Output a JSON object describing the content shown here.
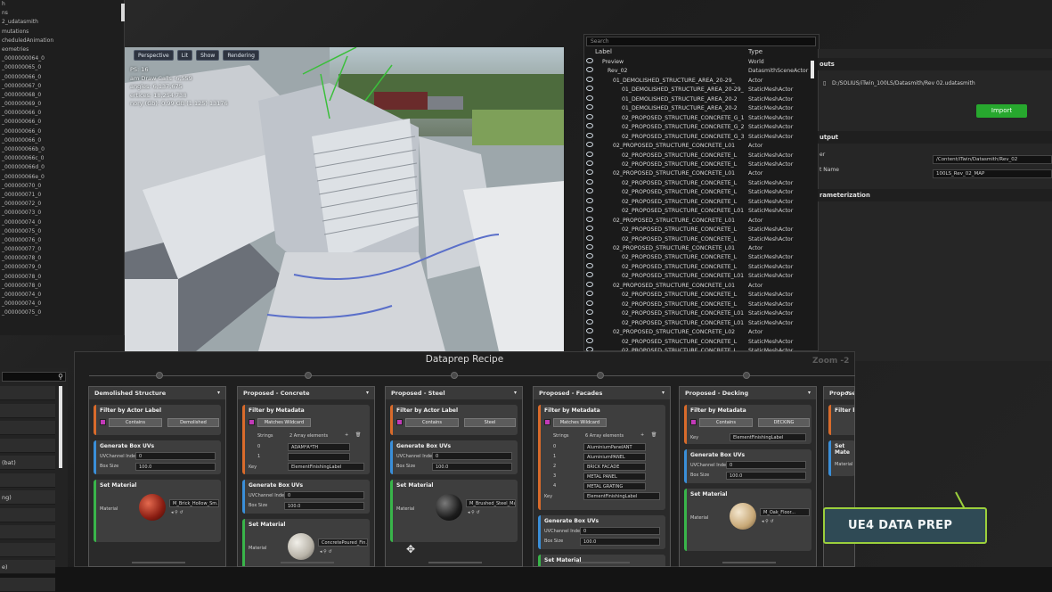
{
  "outliner_left": {
    "rows": [
      "h",
      "ns",
      "2_udatasmith",
      "mutations",
      "cheduledAnimation",
      "eometries",
      "_0000000064_0",
      "_000000065_0",
      "_000000066_0",
      "_000000067_0",
      "_000000068_0",
      "_000000069_0",
      "_000000066_0",
      "_000000066_0",
      "_000000066_0",
      "_000000066_0",
      "_000000066b_0",
      "_000000066c_0",
      "_000000066d_0",
      "_000000066e_0",
      "_000000070_0",
      "_000000071_0",
      "_000000072_0",
      "_000000073_0",
      "_000000074_0",
      "_000000075_0",
      "_000000076_0",
      "_000000077_0",
      "_000000078_0",
      "_000000079_0",
      "_000000078_0",
      "_000000078_0",
      "_000000074_0",
      "_000000074_0",
      "_000000075_0"
    ]
  },
  "viewport": {
    "toolbar": [
      "Perspective",
      "Lit",
      "Show",
      "Rendering"
    ],
    "stats": [
      "PS: 16",
      "am Draw Calls: 6,559",
      "angles: 6,137,675",
      "ertices: 18,254,738",
      "nory (Gb): 0.99 GB (1.125) 13176"
    ]
  },
  "scene_outliner": {
    "search_placeholder": "Search",
    "col_label": "Label",
    "col_type": "Type",
    "rows": [
      {
        "label": "Preview",
        "type": "World"
      },
      {
        "label": "Rev_02",
        "type": "DatasmithSceneActor"
      },
      {
        "label": "01_DEMOLISHED_STRUCTURE_AREA_20-29_",
        "type": "Actor"
      },
      {
        "label": "01_DEMOLISHED_STRUCTURE_AREA_20-29_",
        "type": "StaticMeshActor"
      },
      {
        "label": "01_DEMOLISHED_STRUCTURE_AREA_20-2",
        "type": "StaticMeshActor"
      },
      {
        "label": "01_DEMOLISHED_STRUCTURE_AREA_20-2",
        "type": "StaticMeshActor"
      },
      {
        "label": "02_PROPOSED_STRUCTURE_CONCRETE_G_1",
        "type": "StaticMeshActor"
      },
      {
        "label": "02_PROPOSED_STRUCTURE_CONCRETE_G_2",
        "type": "StaticMeshActor"
      },
      {
        "label": "02_PROPOSED_STRUCTURE_CONCRETE_G_3",
        "type": "StaticMeshActor"
      },
      {
        "label": "02_PROPOSED_STRUCTURE_CONCRETE_L01",
        "type": "Actor"
      },
      {
        "label": "02_PROPOSED_STRUCTURE_CONCRETE_L",
        "type": "StaticMeshActor"
      },
      {
        "label": "02_PROPOSED_STRUCTURE_CONCRETE_L",
        "type": "StaticMeshActor"
      },
      {
        "label": "02_PROPOSED_STRUCTURE_CONCRETE_L01",
        "type": "Actor"
      },
      {
        "label": "02_PROPOSED_STRUCTURE_CONCRETE_L",
        "type": "StaticMeshActor"
      },
      {
        "label": "02_PROPOSED_STRUCTURE_CONCRETE_L",
        "type": "StaticMeshActor"
      },
      {
        "label": "02_PROPOSED_STRUCTURE_CONCRETE_L",
        "type": "StaticMeshActor"
      },
      {
        "label": "02_PROPOSED_STRUCTURE_CONCRETE_L01",
        "type": "StaticMeshActor"
      },
      {
        "label": "02_PROPOSED_STRUCTURE_CONCRETE_L01",
        "type": "Actor"
      },
      {
        "label": "02_PROPOSED_STRUCTURE_CONCRETE_L",
        "type": "StaticMeshActor"
      },
      {
        "label": "02_PROPOSED_STRUCTURE_CONCRETE_L",
        "type": "StaticMeshActor"
      },
      {
        "label": "02_PROPOSED_STRUCTURE_CONCRETE_L01",
        "type": "Actor"
      },
      {
        "label": "02_PROPOSED_STRUCTURE_CONCRETE_L",
        "type": "StaticMeshActor"
      },
      {
        "label": "02_PROPOSED_STRUCTURE_CONCRETE_L",
        "type": "StaticMeshActor"
      },
      {
        "label": "02_PROPOSED_STRUCTURE_CONCRETE_L01",
        "type": "StaticMeshActor"
      },
      {
        "label": "02_PROPOSED_STRUCTURE_CONCRETE_L01",
        "type": "Actor"
      },
      {
        "label": "02_PROPOSED_STRUCTURE_CONCRETE_L",
        "type": "StaticMeshActor"
      },
      {
        "label": "02_PROPOSED_STRUCTURE_CONCRETE_L",
        "type": "StaticMeshActor"
      },
      {
        "label": "02_PROPOSED_STRUCTURE_CONCRETE_L01",
        "type": "StaticMeshActor"
      },
      {
        "label": "02_PROPOSED_STRUCTURE_CONCRETE_L01",
        "type": "StaticMeshActor"
      },
      {
        "label": "02_PROPOSED_STRUCTURE_CONCRETE_L02",
        "type": "Actor"
      },
      {
        "label": "02_PROPOSED_STRUCTURE_CONCRETE_L",
        "type": "StaticMeshActor"
      },
      {
        "label": "02_PROPOSED_STRUCTURE_CONCRETE_L",
        "type": "StaticMeshActor"
      }
    ]
  },
  "import_panel": {
    "section_inputs": "outs",
    "file_path": "D:/SOLIUS/iTwin_100LS/Datasmith/Rev 02.udatasmith",
    "import_label": "Import",
    "section_output": "utput",
    "folder_label": "er",
    "folder_value": "/Content/iTwin/Datasmith/Rev_02",
    "map_label": "t Name",
    "map_value": "100LS_Rev_02_MAP",
    "section_param": "rameterization"
  },
  "lower_left": {
    "items": [
      "",
      "",
      "",
      "",
      "(bat)",
      "",
      "ng)",
      "",
      "",
      "",
      "e)",
      ""
    ]
  },
  "dataprep": {
    "title": "Dataprep Recipe",
    "zoom": "Zoom -2",
    "columns": [
      {
        "title": "Demolished Structure",
        "filter_title": "Filter by Actor Label",
        "filter_mode": "Contains",
        "filter_value": "Demolished",
        "uv_title": "Generate Box UVs",
        "uv_index_label": "UVChannel Index",
        "uv_index": "0",
        "uv_size_label": "Box Size",
        "uv_size": "100.0",
        "mat_title": "Set Material",
        "mat_label": "Material",
        "mat_name": "M_Brick_Hollow_Sm..."
      },
      {
        "title": "Proposed - Concrete",
        "filter_title": "Filter by Metadata",
        "filter_mode": "Matches Wildcard",
        "strings_label": "Strings",
        "strings_count": "2 Array elements",
        "str0": "ADAM*A*TH",
        "str1": "",
        "key_label": "Key",
        "key_value": "ElementFinishingLabel",
        "uv_title": "Generate Box UVs",
        "uv_index_label": "UVChannel Index",
        "uv_index": "0",
        "uv_size_label": "Box Size",
        "uv_size": "100.0",
        "mat_title": "Set Material",
        "mat_label": "Material",
        "mat_name": "ConcretePoured_Fin..."
      },
      {
        "title": "Proposed - Steel",
        "filter_title": "Filter by Actor Label",
        "filter_mode": "Contains",
        "filter_value": "Steel",
        "uv_title": "Generate Box UVs",
        "uv_index_label": "UVChannel Index",
        "uv_index": "0",
        "uv_size_label": "Box Size",
        "uv_size": "100.0",
        "mat_title": "Set Material",
        "mat_label": "Material",
        "mat_name": "M_Brushed_Steel_Mat..."
      },
      {
        "title": "Proposed - Facades",
        "filter_title": "Filter by Metadata",
        "filter_mode": "Matches Wildcard",
        "strings_label": "Strings",
        "strings_count": "6 Array elements",
        "str0": "AluminiumPanelANT",
        "str1": "AluminiumPANEL",
        "str2": "BRICK FACADE",
        "str3": "METAL PANEL",
        "str4": "METAL GRATING",
        "key_label": "Key",
        "key_value": "ElementFinishingLabel",
        "uv_title": "Generate Box UVs",
        "uv_index_label": "UVChannel Index",
        "uv_index": "0",
        "uv_size_label": "Box Size",
        "uv_size": "100.0",
        "mat_title": "Set Material"
      },
      {
        "title": "Proposed - Decking",
        "filter_title": "Filter by Metadata",
        "filter_mode": "Contains",
        "filter_value": "DECKING",
        "key_label": "Key",
        "key_value": "ElementFinishingLabel",
        "uv_title": "Generate Box UVs",
        "uv_index_label": "UVChannel Index",
        "uv_index": "0",
        "uv_size_label": "Box Size",
        "uv_size": "100.0",
        "mat_title": "Set Material",
        "mat_label": "Material",
        "mat_name": "M_Oak_Floor..."
      },
      {
        "title": "Proposed - ",
        "filter_title": "Filter by M",
        "uv_title": "Set Mate",
        "mat_label": "Material"
      }
    ]
  },
  "brand": {
    "text": "UE4 DATA PREP"
  },
  "colors": {
    "import_green": "#27a82e",
    "brand_border": "#9bcf3c",
    "brand_fill": "#2f4a55",
    "filter_accent": "#d96b2b",
    "uv_accent": "#3a8fd9",
    "material_accent": "#39b54a"
  }
}
